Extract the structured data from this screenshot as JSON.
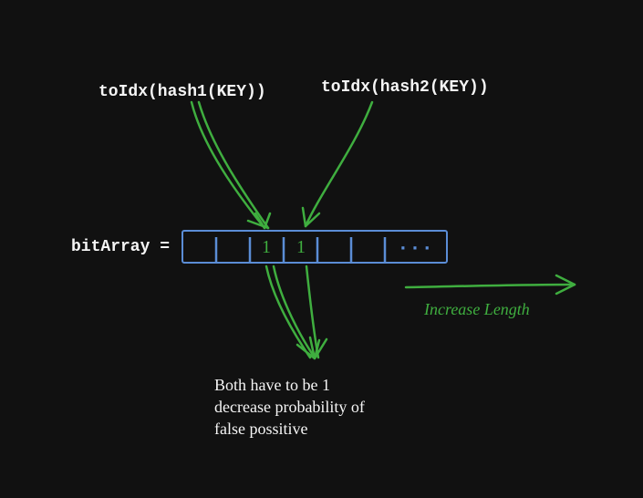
{
  "labels": {
    "hash1": "toIdx(hash1(KEY))",
    "hash2": "toIdx(hash2(KEY))",
    "bitArray": "bitArray =",
    "bitValues": [
      "1",
      "1"
    ],
    "ellipsis": "...",
    "explanation_l1": "Both have to be 1",
    "explanation_l2": "decrease probability of",
    "explanation_l3": "false possitive",
    "increase": "Increase Length"
  },
  "colors": {
    "bg": "#111111",
    "text": "#f5f5f5",
    "blue": "#5b8dd6",
    "green": "#3fae3f"
  }
}
